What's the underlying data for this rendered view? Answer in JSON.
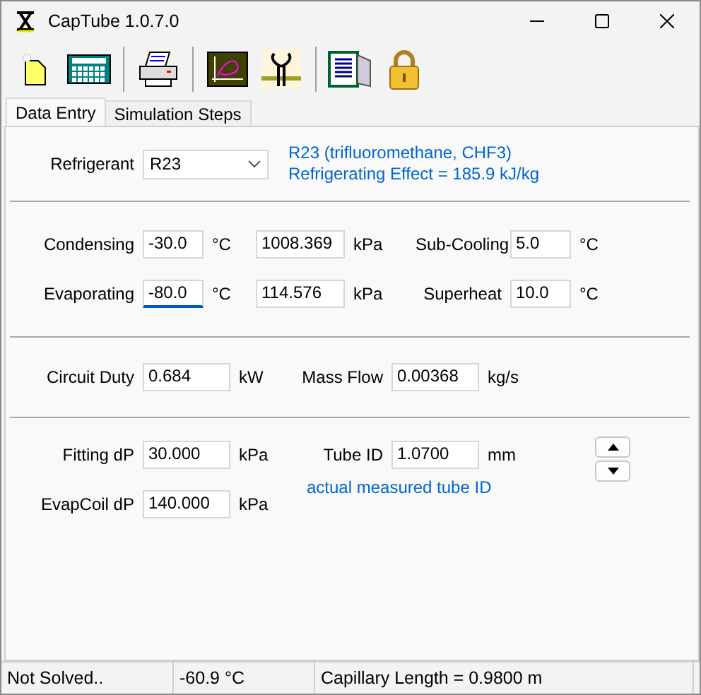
{
  "window": {
    "title": "CapTube 1.0.7.0"
  },
  "tabs": [
    {
      "label": "Data Entry",
      "selected": true
    },
    {
      "label": "Simulation Steps",
      "selected": false
    }
  ],
  "refrigerant": {
    "label": "Refrigerant",
    "value": "R23",
    "info": [
      "R23 (trifluoromethane, CHF3)",
      "Refrigerating Effect = 185.9 kJ/kg"
    ]
  },
  "conditions": [
    {
      "label": "Condensing",
      "temperature": "-30.0",
      "temp_unit": "°C",
      "pressure": "1008.369",
      "pressure_unit": "kPa",
      "extra_label": "Sub-Cooling",
      "extra_value": "5.0",
      "extra_unit": "°C",
      "focused": false
    },
    {
      "label": "Evaporating",
      "temperature": "-80.0",
      "temp_unit": "°C",
      "pressure": "114.576",
      "pressure_unit": "kPa",
      "extra_label": "Superheat",
      "extra_value": "10.0",
      "extra_unit": "°C",
      "focused": true
    }
  ],
  "flow": [
    {
      "label": "Circuit Duty",
      "value": "0.684",
      "unit": "kW"
    },
    {
      "label": "Mass Flow",
      "value": "0.00368",
      "unit": "kg/s"
    }
  ],
  "tube": {
    "drops": [
      {
        "label": "Fitting dP",
        "value": "30.000",
        "unit": "kPa"
      },
      {
        "label": "EvapCoil dP",
        "value": "140.000",
        "unit": "kPa"
      }
    ],
    "tube_id": {
      "label": "Tube ID",
      "value": "1.0700",
      "unit": "mm"
    },
    "note": "actual measured tube ID"
  },
  "status_bar": [
    "Not Solved..",
    "-60.9 °C",
    "Capillary Length = 0.9800 m"
  ]
}
